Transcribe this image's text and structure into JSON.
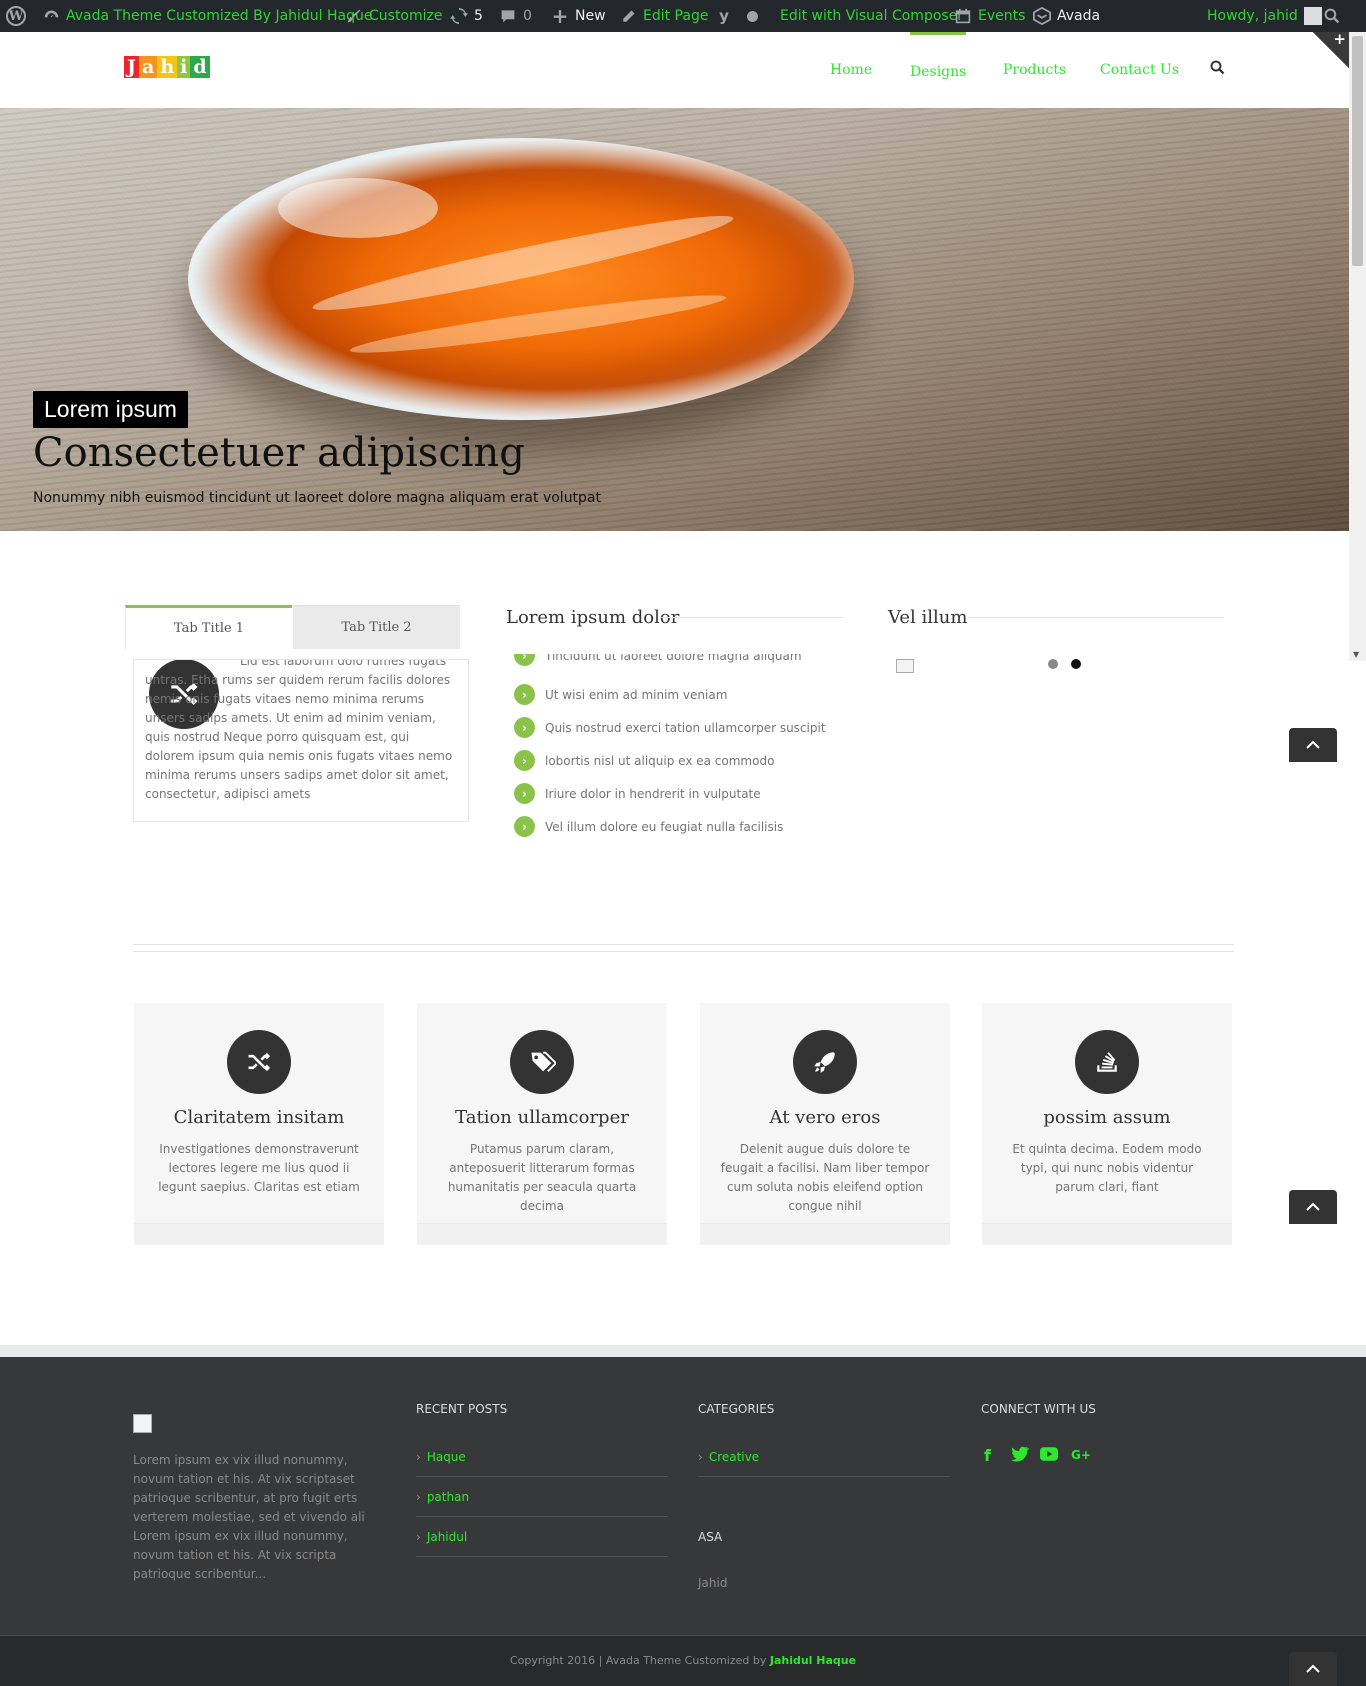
{
  "adminbar": {
    "site_name": "Avada Theme Customized By Jahidul Haque",
    "customize": "Customize",
    "updates_count": "5",
    "comments_count": "0",
    "new_label": "New",
    "edit_page": "Edit Page",
    "visual_composer": "Edit with Visual Composer",
    "events": "Events",
    "avada": "Avada",
    "howdy": "Howdy, jahid"
  },
  "header": {
    "logo_letters": [
      "J",
      "a",
      "h",
      "i",
      "d"
    ],
    "logo_colors": [
      "#e8262b",
      "#f7941d",
      "#f4c51a",
      "#8dc63f",
      "#2ea84a"
    ],
    "nav": [
      "Home",
      "Designs",
      "Products",
      "Contact Us"
    ],
    "active_nav": "Designs",
    "corner_plus": "+"
  },
  "hero": {
    "tag": "Lorem ipsum",
    "title": "Consectetuer adipiscing",
    "subtitle": "Nonummy nibh euismod tincidunt ut laoreet dolore magna aliquam erat volutpat"
  },
  "tabs": {
    "titles": [
      "Tab Title 1",
      "Tab Title 2"
    ],
    "content": "Lid est laborum dolo rumes fugats untras. Etha rums ser quidem rerum facilis dolores nemis onis fugats vitaes nemo minima rerums unsers sadips amets. Ut enim ad minim veniam, quis nostrud Neque porro quisquam est, qui dolorem ipsum quia nemis onis fugats vitaes nemo minima rerums unsers sadips amet dolor sit amet, consectetur, adipisci amets"
  },
  "checklist": {
    "title": "Lorem ipsum dolor",
    "items": [
      "Tincidunt ut laoreet dolore magna aliquam",
      "Ut wisi enim ad minim veniam",
      "Quis nostrud exerci tation ullamcorper suscipit",
      "lobortis nisl ut aliquip ex ea commodo",
      "Iriure dolor in hendrerit in vulputate",
      "Vel illum dolore eu feugiat nulla facilisis"
    ]
  },
  "widget": {
    "title": "Vel illum",
    "dot_colors": [
      "#888888",
      "#111111"
    ]
  },
  "features": [
    {
      "icon": "shuffle-icon",
      "title": "Claritatem insitam",
      "text": "Investigationes demonstraverunt lectores legere me lius quod ii legunt saepius. Claritas est etiam"
    },
    {
      "icon": "tags-icon",
      "title": "Tation ullamcorper",
      "text": "Putamus parum claram, anteposuerit litterarum formas humanitatis per seacula quarta decima"
    },
    {
      "icon": "rocket-icon",
      "title": "At vero eros",
      "text": "Delenit augue duis dolore te feugait a facilisi. Nam liber tempor cum soluta nobis eleifend option congue nihil"
    },
    {
      "icon": "stack-icon",
      "title": "possim assum",
      "text": "Et quinta decima. Eodem modo typi, qui nunc nobis videntur parum clari, fiant"
    }
  ],
  "footer": {
    "about": "Lorem ipsum ex vix illud nonummy, novum tation et his. At vix scriptaset patrioque scribentur, at pro fugit erts verterem molestiae, sed et vivendo ali Lorem ipsum ex vix illud nonummy, novum tation et his. At vix scripta patrioque scribentur...",
    "recent_posts_title": "RECENT POSTS",
    "recent_posts": [
      "Haque",
      "pathan",
      "Jahidul"
    ],
    "categories_title": "CATEGORIES",
    "categories": [
      "Creative"
    ],
    "asa_title": "ASA",
    "asa_text": "Jahid",
    "connect_title": "CONNECT WITH US",
    "social": [
      "f",
      "t",
      "▶",
      "G+"
    ],
    "copyright_prefix": "Copyright 2016 | Avada Theme Customized by ",
    "copyright_author": "Jahidul Haque"
  },
  "colors": {
    "accent_green": "#8bc34a",
    "link_green": "#2ee82e",
    "dark": "#333333",
    "footer_bg": "#363839"
  }
}
